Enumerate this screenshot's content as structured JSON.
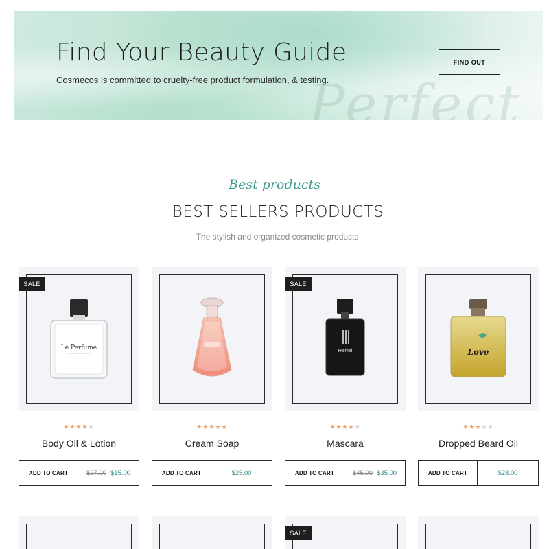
{
  "banner": {
    "title": "Find Your Beauty Guide",
    "subtitle": "Cosmecos is committed to cruelty-free product formulation, & testing.",
    "button_label": "FIND OUT",
    "script_watermark": "Perfect"
  },
  "section": {
    "script_title": "Best products",
    "title": "BEST SELLERS PRODUCTS",
    "subtitle": "The stylish and organized cosmetic products"
  },
  "products": [
    {
      "name": "Body Oil & Lotion",
      "sale_badge": "SALE",
      "rating": 4,
      "old_price": "$27.00",
      "price": "$15.00",
      "cart_label": "ADD TO CART",
      "bottle_label": "Lé Perfume"
    },
    {
      "name": "Cream Soap",
      "sale_badge": "",
      "rating": 5,
      "old_price": "",
      "price": "$25.00",
      "cart_label": "ADD TO CART"
    },
    {
      "name": "Mascara",
      "sale_badge": "SALE",
      "rating": 4,
      "old_price": "$45.00",
      "price": "$35.00",
      "cart_label": "ADD TO CART",
      "bottle_label": "Hariel"
    },
    {
      "name": "Dropped Beard Oil",
      "sale_badge": "",
      "rating": 3,
      "old_price": "",
      "price": "$28.00",
      "cart_label": "ADD TO CART",
      "bottle_label": "Love"
    }
  ],
  "second_row": [
    {
      "sale_badge": ""
    },
    {
      "sale_badge": ""
    },
    {
      "sale_badge": "SALE"
    },
    {
      "sale_badge": ""
    }
  ],
  "colors": {
    "accent": "#2f8f87",
    "star": "#f0a173",
    "badge": "#1e1e1e"
  }
}
